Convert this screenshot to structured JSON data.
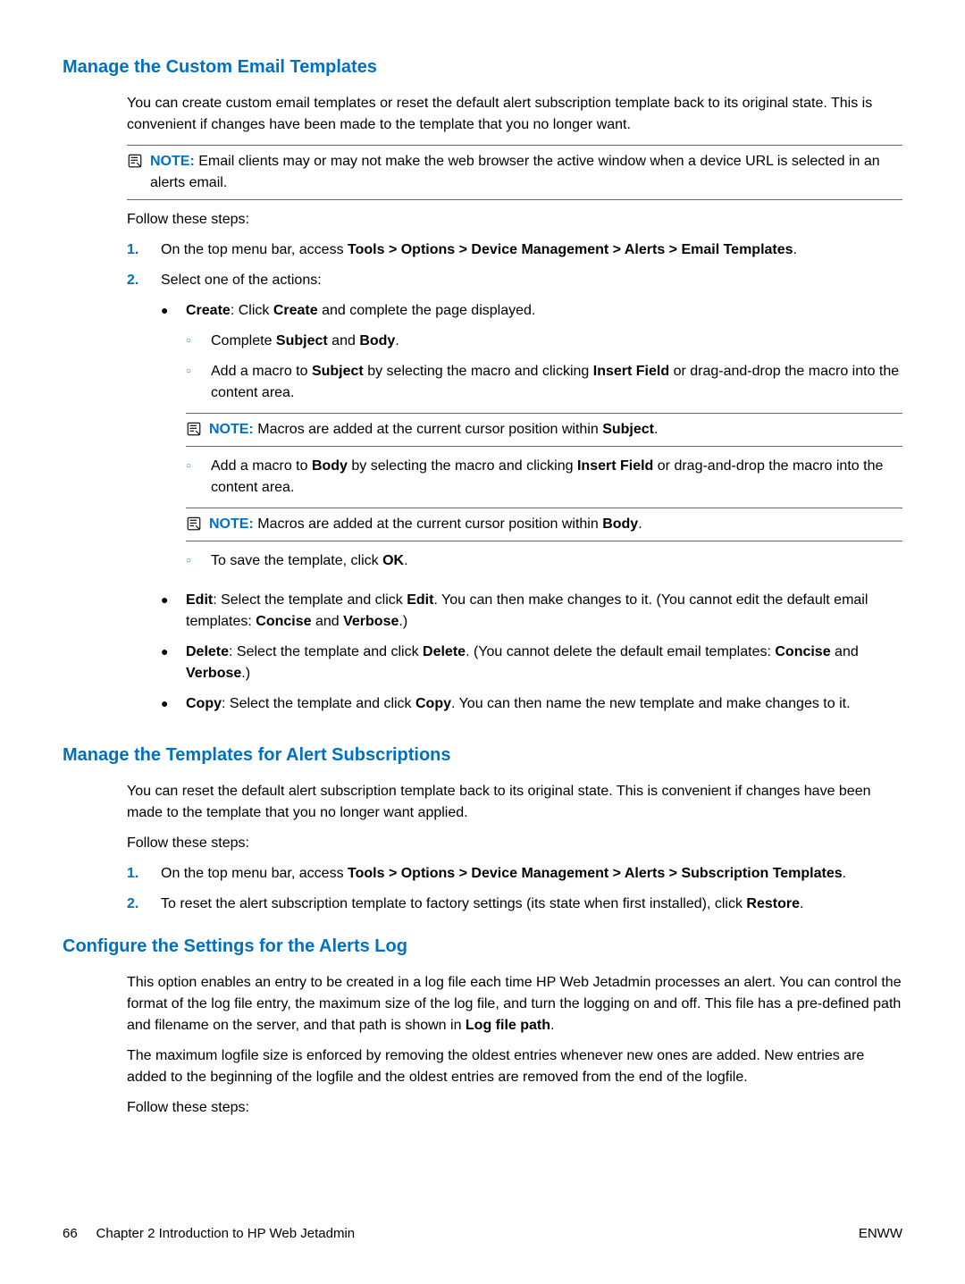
{
  "section1": {
    "heading": "Manage the Custom Email Templates",
    "intro": "You can create custom email templates or reset the default alert subscription template back to its original state. This is convenient if changes have been made to the template that you no longer want.",
    "note": {
      "label": "NOTE:",
      "text": "Email clients may or may not make the web browser the active window when a device URL is selected in an alerts email."
    },
    "follow": "Follow these steps:",
    "step1_pre": "On the top menu bar, access ",
    "step1_bold": "Tools > Options > Device Management > Alerts > Email Templates",
    "step1_post": ".",
    "step2": "Select one of the actions:",
    "create_bold": "Create",
    "create_text": ": Click ",
    "create_bold2": "Create",
    "create_text2": " and complete the page displayed.",
    "sub_complete_pre": "Complete ",
    "sub_complete_b1": "Subject",
    "sub_complete_mid": " and ",
    "sub_complete_b2": "Body",
    "sub_complete_post": ".",
    "sub_addsubj_pre": "Add a macro to ",
    "sub_addsubj_b1": "Subject",
    "sub_addsubj_mid": " by selecting the macro and clicking ",
    "sub_addsubj_b2": "Insert Field",
    "sub_addsubj_post": " or drag-and-drop the macro into the content area.",
    "note_subj_label": "NOTE:",
    "note_subj_pre": "Macros are added at the current cursor position within ",
    "note_subj_b": "Subject",
    "note_subj_post": ".",
    "sub_addbody_pre": "Add a macro to ",
    "sub_addbody_b1": "Body",
    "sub_addbody_mid": " by selecting the macro and clicking ",
    "sub_addbody_b2": "Insert Field",
    "sub_addbody_post": " or drag-and-drop the macro into the content area.",
    "note_body_label": "NOTE:",
    "note_body_pre": "Macros are added at the current cursor position within ",
    "note_body_b": "Body",
    "note_body_post": ".",
    "sub_save_pre": "To save the template, click ",
    "sub_save_b": "OK",
    "sub_save_post": ".",
    "edit_b1": "Edit",
    "edit_t1": ": Select the template and click ",
    "edit_b2": "Edit",
    "edit_t2": ". You can then make changes to it. (You cannot edit the default email templates: ",
    "edit_b3": "Concise",
    "edit_t3": " and ",
    "edit_b4": "Verbose",
    "edit_t4": ".)",
    "del_b1": "Delete",
    "del_t1": ": Select the template and click ",
    "del_b2": "Delete",
    "del_t2": ". (You cannot delete the default email templates: ",
    "del_b3": "Concise",
    "del_t3": " and ",
    "del_b4": "Verbose",
    "del_t4": ".)",
    "copy_b1": "Copy",
    "copy_t1": ": Select the template and click ",
    "copy_b2": "Copy",
    "copy_t2": ". You can then name the new template and make changes to it."
  },
  "section2": {
    "heading": "Manage the Templates for Alert Subscriptions",
    "intro": "You can reset the default alert subscription template back to its original state. This is convenient if changes have been made to the template that you no longer want applied.",
    "follow": "Follow these steps:",
    "step1_pre": "On the top menu bar, access ",
    "step1_bold": "Tools > Options > Device Management > Alerts > Subscription Templates",
    "step1_post": ".",
    "step2_pre": "To reset the alert subscription template to factory settings (its state when first installed), click ",
    "step2_bold": "Restore",
    "step2_post": "."
  },
  "section3": {
    "heading": "Configure the Settings for the Alerts Log",
    "p1_pre": "This option enables an entry to be created in a log file each time HP Web Jetadmin processes an alert. You can control the format of the log file entry, the maximum size of the log file, and turn the logging on and off. This file has a pre-defined path and filename on the server, and that path is shown in ",
    "p1_bold": "Log file path",
    "p1_post": ".",
    "p2": "The maximum logfile size is enforced by removing the oldest entries whenever new ones are added. New entries are added to the beginning of the logfile and the oldest entries are removed from the end of the logfile.",
    "follow": "Follow these steps:"
  },
  "footer": {
    "left_page": "66",
    "left_text": "Chapter 2   Introduction to HP Web Jetadmin",
    "right": "ENWW"
  }
}
